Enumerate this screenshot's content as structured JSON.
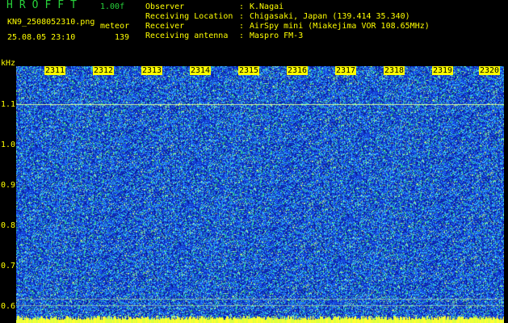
{
  "header": {
    "app_title": "HROFFT",
    "version": "1.00f",
    "filename": "KN9_2508052310.png",
    "mode": "meteor",
    "datetime": "25.08.05 23:10",
    "count": "139"
  },
  "metadata": [
    {
      "label": "Observer",
      "value": "K.Nagai"
    },
    {
      "label": "Receiving Location",
      "value": "Chigasaki, Japan (139.414 35.340)"
    },
    {
      "label": "Receiver",
      "value": "AirSpy mini (Miakejima VOR 108.65MHz)"
    },
    {
      "label": "Receiving antenna",
      "value": "Maspro FM-3"
    }
  ],
  "separator": ":",
  "axis": {
    "unit": "kHz",
    "y_ticks": [
      "1.1",
      "1.0",
      "0.9",
      "0.8",
      "0.7",
      "0.6"
    ],
    "x_ticks": [
      "2311",
      "2312",
      "2313",
      "2314",
      "2315",
      "2316",
      "2317",
      "2318",
      "2319",
      "2320"
    ]
  },
  "colors": {
    "background": "#000000",
    "waterfall_base": "#0a1a9a",
    "noise_cyan": "#3fd0ff",
    "noise_green": "#35e07a",
    "signal_yellow": "#ffff33",
    "header_green": "#27d13a",
    "header_yellow": "#ffff00"
  }
}
